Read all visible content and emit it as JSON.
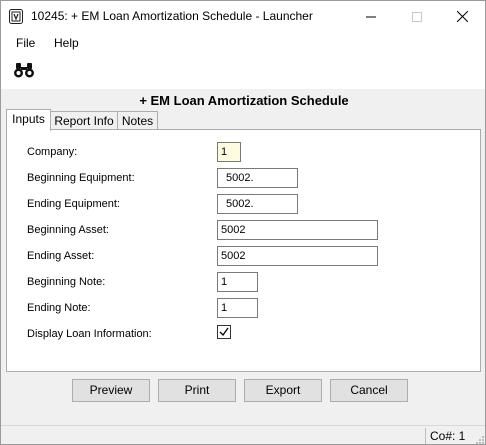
{
  "window": {
    "title": "10245: + EM Loan Amortization Schedule - Launcher"
  },
  "menu": [
    "File",
    "Help"
  ],
  "toolbar": {
    "find_icon": "binoculars-icon"
  },
  "heading": "+ EM Loan Amortization Schedule",
  "tabs": [
    "Inputs",
    "Report Info",
    "Notes"
  ],
  "active_tab": "Inputs",
  "inputs": {
    "company": {
      "label": "Company:",
      "value": "1"
    },
    "beginning_equipment": {
      "label": "Beginning Equipment:",
      "value": "5002."
    },
    "ending_equipment": {
      "label": "Ending Equipment:",
      "value": "5002."
    },
    "beginning_asset": {
      "label": "Beginning Asset:",
      "value": "5002"
    },
    "ending_asset": {
      "label": "Ending Asset:",
      "value": "5002"
    },
    "beginning_note": {
      "label": "Beginning Note:",
      "value": "1"
    },
    "ending_note": {
      "label": "Ending Note:",
      "value": "1"
    },
    "display_loan_information": {
      "label": "Display Loan Information:",
      "checked": true
    }
  },
  "buttons": [
    "Preview",
    "Print",
    "Export",
    "Cancel"
  ],
  "status": {
    "company": "Co#: 1"
  }
}
